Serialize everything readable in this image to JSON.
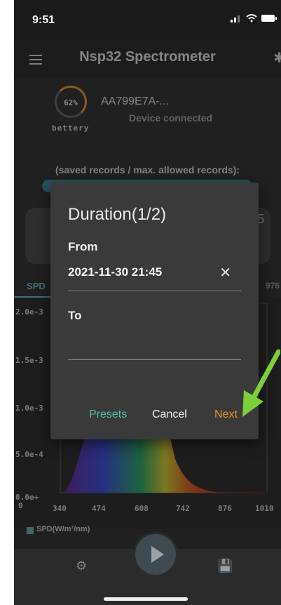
{
  "status_bar": {
    "time": "9:51"
  },
  "app_bar": {
    "title": "Nsp32 Spectrometer"
  },
  "device": {
    "battery_percent": "62%",
    "battery_label": "bettery",
    "id": "AA799E7A-...",
    "status": "Device connected"
  },
  "records": {
    "label": "(saved records / max. allowed records):"
  },
  "card": {
    "partial_value": "5"
  },
  "tabs": {
    "spd_label": "SPD",
    "right_label": "976"
  },
  "chart": {
    "y_ticks": [
      "2.0e-3",
      "1.5e-3",
      "1.0e-3",
      "5.0e-4",
      "0.0e+"
    ],
    "y_zero": "0",
    "x_ticks": [
      "340",
      "474",
      "608",
      "742",
      "876",
      "1010"
    ],
    "legend": "SPD(W/m²/nm)"
  },
  "chart_data": {
    "type": "area",
    "x": [
      340,
      474,
      608,
      742,
      876,
      1010
    ],
    "xlabel": "",
    "ylabel": "",
    "ylim": [
      0,
      0.002
    ],
    "series": [
      {
        "name": "SPD(W/m²/nm)"
      }
    ]
  },
  "dialog": {
    "title": "Duration(1/2)",
    "from_label": "From",
    "from_value": "2021-11-30 21:45",
    "to_label": "To",
    "to_value": "",
    "presets_label": "Presets",
    "cancel_label": "Cancel",
    "next_label": "Next"
  },
  "colors": {
    "accent_teal": "#4fc1a6",
    "accent_orange": "#e8922a",
    "arrow_green": "#7ccf3a"
  }
}
